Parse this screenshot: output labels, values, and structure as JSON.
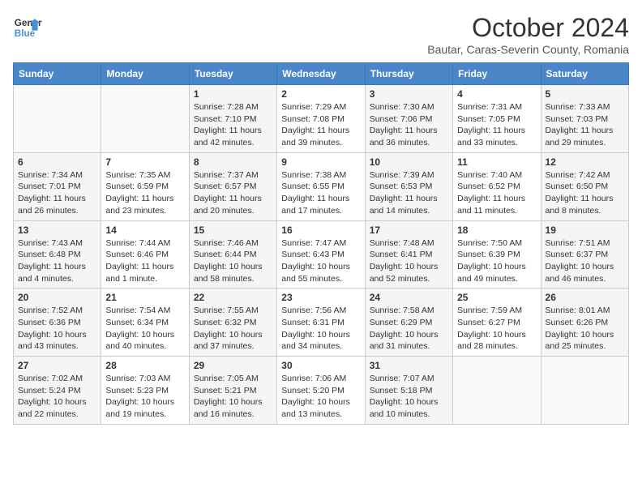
{
  "header": {
    "logo_line1": "General",
    "logo_line2": "Blue",
    "month_title": "October 2024",
    "subtitle": "Bautar, Caras-Severin County, Romania"
  },
  "weekdays": [
    "Sunday",
    "Monday",
    "Tuesday",
    "Wednesday",
    "Thursday",
    "Friday",
    "Saturday"
  ],
  "weeks": [
    [
      {
        "day": "",
        "sunrise": "",
        "sunset": "",
        "daylight": ""
      },
      {
        "day": "",
        "sunrise": "",
        "sunset": "",
        "daylight": ""
      },
      {
        "day": "1",
        "sunrise": "Sunrise: 7:28 AM",
        "sunset": "Sunset: 7:10 PM",
        "daylight": "Daylight: 11 hours and 42 minutes."
      },
      {
        "day": "2",
        "sunrise": "Sunrise: 7:29 AM",
        "sunset": "Sunset: 7:08 PM",
        "daylight": "Daylight: 11 hours and 39 minutes."
      },
      {
        "day": "3",
        "sunrise": "Sunrise: 7:30 AM",
        "sunset": "Sunset: 7:06 PM",
        "daylight": "Daylight: 11 hours and 36 minutes."
      },
      {
        "day": "4",
        "sunrise": "Sunrise: 7:31 AM",
        "sunset": "Sunset: 7:05 PM",
        "daylight": "Daylight: 11 hours and 33 minutes."
      },
      {
        "day": "5",
        "sunrise": "Sunrise: 7:33 AM",
        "sunset": "Sunset: 7:03 PM",
        "daylight": "Daylight: 11 hours and 29 minutes."
      }
    ],
    [
      {
        "day": "6",
        "sunrise": "Sunrise: 7:34 AM",
        "sunset": "Sunset: 7:01 PM",
        "daylight": "Daylight: 11 hours and 26 minutes."
      },
      {
        "day": "7",
        "sunrise": "Sunrise: 7:35 AM",
        "sunset": "Sunset: 6:59 PM",
        "daylight": "Daylight: 11 hours and 23 minutes."
      },
      {
        "day": "8",
        "sunrise": "Sunrise: 7:37 AM",
        "sunset": "Sunset: 6:57 PM",
        "daylight": "Daylight: 11 hours and 20 minutes."
      },
      {
        "day": "9",
        "sunrise": "Sunrise: 7:38 AM",
        "sunset": "Sunset: 6:55 PM",
        "daylight": "Daylight: 11 hours and 17 minutes."
      },
      {
        "day": "10",
        "sunrise": "Sunrise: 7:39 AM",
        "sunset": "Sunset: 6:53 PM",
        "daylight": "Daylight: 11 hours and 14 minutes."
      },
      {
        "day": "11",
        "sunrise": "Sunrise: 7:40 AM",
        "sunset": "Sunset: 6:52 PM",
        "daylight": "Daylight: 11 hours and 11 minutes."
      },
      {
        "day": "12",
        "sunrise": "Sunrise: 7:42 AM",
        "sunset": "Sunset: 6:50 PM",
        "daylight": "Daylight: 11 hours and 8 minutes."
      }
    ],
    [
      {
        "day": "13",
        "sunrise": "Sunrise: 7:43 AM",
        "sunset": "Sunset: 6:48 PM",
        "daylight": "Daylight: 11 hours and 4 minutes."
      },
      {
        "day": "14",
        "sunrise": "Sunrise: 7:44 AM",
        "sunset": "Sunset: 6:46 PM",
        "daylight": "Daylight: 11 hours and 1 minute."
      },
      {
        "day": "15",
        "sunrise": "Sunrise: 7:46 AM",
        "sunset": "Sunset: 6:44 PM",
        "daylight": "Daylight: 10 hours and 58 minutes."
      },
      {
        "day": "16",
        "sunrise": "Sunrise: 7:47 AM",
        "sunset": "Sunset: 6:43 PM",
        "daylight": "Daylight: 10 hours and 55 minutes."
      },
      {
        "day": "17",
        "sunrise": "Sunrise: 7:48 AM",
        "sunset": "Sunset: 6:41 PM",
        "daylight": "Daylight: 10 hours and 52 minutes."
      },
      {
        "day": "18",
        "sunrise": "Sunrise: 7:50 AM",
        "sunset": "Sunset: 6:39 PM",
        "daylight": "Daylight: 10 hours and 49 minutes."
      },
      {
        "day": "19",
        "sunrise": "Sunrise: 7:51 AM",
        "sunset": "Sunset: 6:37 PM",
        "daylight": "Daylight: 10 hours and 46 minutes."
      }
    ],
    [
      {
        "day": "20",
        "sunrise": "Sunrise: 7:52 AM",
        "sunset": "Sunset: 6:36 PM",
        "daylight": "Daylight: 10 hours and 43 minutes."
      },
      {
        "day": "21",
        "sunrise": "Sunrise: 7:54 AM",
        "sunset": "Sunset: 6:34 PM",
        "daylight": "Daylight: 10 hours and 40 minutes."
      },
      {
        "day": "22",
        "sunrise": "Sunrise: 7:55 AM",
        "sunset": "Sunset: 6:32 PM",
        "daylight": "Daylight: 10 hours and 37 minutes."
      },
      {
        "day": "23",
        "sunrise": "Sunrise: 7:56 AM",
        "sunset": "Sunset: 6:31 PM",
        "daylight": "Daylight: 10 hours and 34 minutes."
      },
      {
        "day": "24",
        "sunrise": "Sunrise: 7:58 AM",
        "sunset": "Sunset: 6:29 PM",
        "daylight": "Daylight: 10 hours and 31 minutes."
      },
      {
        "day": "25",
        "sunrise": "Sunrise: 7:59 AM",
        "sunset": "Sunset: 6:27 PM",
        "daylight": "Daylight: 10 hours and 28 minutes."
      },
      {
        "day": "26",
        "sunrise": "Sunrise: 8:01 AM",
        "sunset": "Sunset: 6:26 PM",
        "daylight": "Daylight: 10 hours and 25 minutes."
      }
    ],
    [
      {
        "day": "27",
        "sunrise": "Sunrise: 7:02 AM",
        "sunset": "Sunset: 5:24 PM",
        "daylight": "Daylight: 10 hours and 22 minutes."
      },
      {
        "day": "28",
        "sunrise": "Sunrise: 7:03 AM",
        "sunset": "Sunset: 5:23 PM",
        "daylight": "Daylight: 10 hours and 19 minutes."
      },
      {
        "day": "29",
        "sunrise": "Sunrise: 7:05 AM",
        "sunset": "Sunset: 5:21 PM",
        "daylight": "Daylight: 10 hours and 16 minutes."
      },
      {
        "day": "30",
        "sunrise": "Sunrise: 7:06 AM",
        "sunset": "Sunset: 5:20 PM",
        "daylight": "Daylight: 10 hours and 13 minutes."
      },
      {
        "day": "31",
        "sunrise": "Sunrise: 7:07 AM",
        "sunset": "Sunset: 5:18 PM",
        "daylight": "Daylight: 10 hours and 10 minutes."
      },
      {
        "day": "",
        "sunrise": "",
        "sunset": "",
        "daylight": ""
      },
      {
        "day": "",
        "sunrise": "",
        "sunset": "",
        "daylight": ""
      }
    ]
  ]
}
